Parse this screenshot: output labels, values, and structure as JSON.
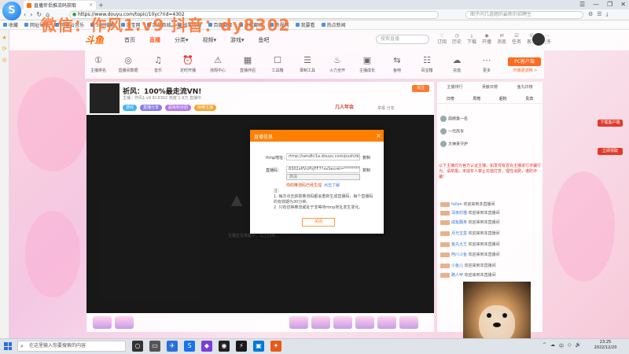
{
  "browser": {
    "tab_title": "直播伴侣推流码获取",
    "tab_close": "×",
    "new_tab": "+",
    "address": "https://www.douyu.com/topic/10yc?rid=4302",
    "search_placeholder": "图子问几道题的最新的招聘生",
    "window_controls": [
      "☰",
      "—",
      "❐",
      "✕"
    ],
    "nav_buttons": [
      "‹",
      "›",
      "↻",
      "⌂"
    ],
    "toolbar_icons": [
      "⚙",
      "☰",
      "⤓"
    ],
    "logo_glyph": "S",
    "bookmarks": [
      "收藏",
      "网址导航",
      "网易云音乐",
      "360搜索",
      "淘宝网",
      "京东商城",
      "拍案惊奇",
      "百度翻译",
      "谷歌翻译",
      "央视网",
      "我要看",
      "热点新闻"
    ],
    "side_icons": [
      "★",
      "⟳",
      "◎"
    ]
  },
  "watermark": "微信：作风1.v9 抖音：dy8302",
  "douyu": {
    "logo": "斗鱼",
    "nav": [
      "首页",
      "直播",
      "分类▾",
      "视频▾",
      "游戏▾",
      "鱼吧"
    ],
    "nav_active_index": 1,
    "search_placeholder": "搜索直播",
    "header_icons": [
      "订阅",
      "历史",
      "下载",
      "开播",
      "消息",
      "任务",
      "客服",
      "更多"
    ],
    "tools": [
      {
        "glyph": "①",
        "label": "主播排名"
      },
      {
        "glyph": "◎",
        "label": "直播间数据"
      },
      {
        "glyph": "♫",
        "label": "音乐"
      },
      {
        "glyph": "⏰",
        "label": "定时开播"
      },
      {
        "glyph": "⚠",
        "label": "违规中心"
      },
      {
        "glyph": "▦",
        "label": "直播伴侣"
      },
      {
        "glyph": "☐",
        "label": "工具箱"
      },
      {
        "glyph": "☰",
        "label": "录制工具"
      },
      {
        "glyph": "♨",
        "label": "火力全开"
      },
      {
        "glyph": "▣",
        "label": "主播成长"
      },
      {
        "glyph": "⇆",
        "label": "鱼吧"
      },
      {
        "glyph": "☷",
        "label": "百宝箱"
      },
      {
        "glyph": "☁",
        "label": "充值"
      },
      {
        "glyph": "⋯",
        "label": "更多"
      }
    ],
    "pc_button": "PC客户端",
    "pc_sub": "开播更流畅 >"
  },
  "room": {
    "title": "祈风：100%最走流VN!",
    "meta": "主播：作风1.v9  ID:8302  热度 1.9万  直播中",
    "tags": [
      {
        "label": "游戏",
        "color": "#3cb3ff"
      },
      {
        "label": "直播分享",
        "color": "#8a7be8"
      },
      {
        "label": "超级粉丝团",
        "color": "#b476e8"
      },
      {
        "label": "荣耀主播",
        "color": "#f7a42d"
      }
    ],
    "side_label": "几人年会",
    "report_label": "举报 分享",
    "follow_label": "关注",
    "player_status": "主播正在准备中，马上回来..."
  },
  "rightpanel": {
    "head": [
      "主播排行",
      "贡献日榜",
      "鱼丸日榜"
    ],
    "tabs": [
      "日榜",
      "周榜",
      "超粉",
      "贵宾"
    ],
    "ranks": [
      "周榜第一名",
      "一代风华",
      "大神来守护"
    ],
    "notice": "以下主播均为官方认证主播，如发现有冒充主播进行诈骗行为，请举报。未成年人禁止充值打赏，理性消费，谨防诈骗！",
    "chats": [
      {
        "name": "fallen",
        "msg": "欢迎来到本直播间"
      },
      {
        "name": "深夜的猫",
        "msg": "欢迎来到本直播间"
      },
      {
        "name": "咸鱼翻身",
        "msg": "欢迎来到本直播间"
      },
      {
        "name": "月光宝盒",
        "msg": "欢迎来到本直播间"
      },
      {
        "name": "鱼丸大王",
        "msg": "欢迎来到本直播间"
      },
      {
        "name": "阿川斗鱼",
        "msg": "欢迎来到本直播间"
      },
      {
        "name": "小鱼儿",
        "msg": "欢迎来到本直播间"
      },
      {
        "name": "路人甲",
        "msg": "欢迎来到本直播间"
      }
    ]
  },
  "ad": {
    "buttons": [
      "下载客户端",
      "立即领取"
    ]
  },
  "modal": {
    "title": "直播信息",
    "close": "×",
    "rtmp_label": "rtmp地址：",
    "rtmp_value": "rtmp://sendtc1a.douyu.com/push/douyu",
    "key_label": "直播码：",
    "key_value": "8302xIfVcPhJFF7?xxSecret=**********",
    "copy": "复制",
    "mode_value": "高清",
    "warn": "你的推流码已经生成",
    "warn_link": "点击了解",
    "notes_title": "注：",
    "note1": "1. 每次点击获取推流码都会重新生成直播码，每个直播码的有效期为30分钟。",
    "note2": "2. 只有切换推流或处于非等待rtmp地址发生变化。",
    "close_button": "关闭"
  },
  "taskbar": {
    "search_placeholder": "在这里输入你要搜索的内容",
    "search_icon": "⌕",
    "apps": [
      {
        "glyph": "○",
        "color": "#333"
      },
      {
        "glyph": "▭",
        "color": "#555"
      },
      {
        "glyph": "✈",
        "color": "#2b6fd6"
      },
      {
        "glyph": "S",
        "color": "#1a73e8"
      },
      {
        "glyph": "◆",
        "color": "#7a3ed6"
      },
      {
        "glyph": "◉",
        "color": "#222"
      },
      {
        "glyph": "⚡",
        "color": "#1a1a1a"
      },
      {
        "glyph": "▣",
        "color": "#0078d4"
      },
      {
        "glyph": "✦",
        "color": "#e85a1a"
      }
    ],
    "tray": [
      "^",
      "☁",
      "中",
      "◇",
      "🔊"
    ],
    "time": "23:25",
    "date": "2022/12/20"
  }
}
